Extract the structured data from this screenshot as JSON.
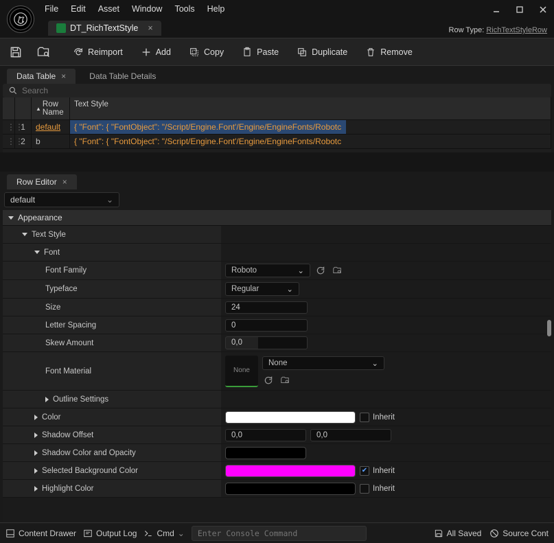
{
  "menu": {
    "file": "File",
    "edit": "Edit",
    "asset": "Asset",
    "window": "Window",
    "tools": "Tools",
    "help": "Help"
  },
  "file_tab": {
    "name": "DT_RichTextStyle"
  },
  "row_type": {
    "label": "Row Type:",
    "value": "RichTextStyleRow"
  },
  "toolbar": {
    "reimport": "Reimport",
    "add": "Add",
    "copy": "Copy",
    "paste": "Paste",
    "duplicate": "Duplicate",
    "remove": "Remove"
  },
  "tabs": {
    "data_table": "Data Table",
    "details": "Data Table Details",
    "row_editor": "Row Editor"
  },
  "search": {
    "placeholder": "Search"
  },
  "table": {
    "headers": {
      "row_name": "Row Name",
      "text_style": "Text Style"
    },
    "rows": [
      {
        "index": "1",
        "name": "default",
        "value": "{ \"Font\": { \"FontObject\": \"/Script/Engine.Font'/Engine/EngineFonts/Robotc"
      },
      {
        "index": "2",
        "name": "b",
        "value": "{ \"Font\": { \"FontObject\": \"/Script/Engine.Font'/Engine/EngineFonts/Robotc"
      }
    ]
  },
  "row_selector": {
    "value": "default"
  },
  "props": {
    "appearance": "Appearance",
    "text_style": "Text Style",
    "font": "Font",
    "font_family": {
      "label": "Font Family",
      "value": "Roboto"
    },
    "typeface": {
      "label": "Typeface",
      "value": "Regular"
    },
    "size": {
      "label": "Size",
      "value": "24"
    },
    "letter_spacing": {
      "label": "Letter Spacing",
      "value": "0"
    },
    "skew": {
      "label": "Skew Amount",
      "value": "0,0"
    },
    "font_material": {
      "label": "Font Material",
      "thumb": "None",
      "value": "None"
    },
    "outline": "Outline Settings",
    "color": {
      "label": "Color",
      "swatch": "#ffffff",
      "inherit_label": "Inherit",
      "inherit": false
    },
    "shadow_offset": {
      "label": "Shadow Offset",
      "x": "0,0",
      "y": "0,0"
    },
    "shadow_color": {
      "label": "Shadow Color and Opacity",
      "swatch": "#000000"
    },
    "selected_bg": {
      "label": "Selected Background Color",
      "swatch": "#ff00ff",
      "inherit_label": "Inherit",
      "inherit": true
    },
    "highlight": {
      "label": "Highlight Color",
      "swatch": "#000000",
      "inherit_label": "Inherit",
      "inherit": false
    }
  },
  "status": {
    "content_drawer": "Content Drawer",
    "output_log": "Output Log",
    "cmd": "Cmd",
    "console_placeholder": "Enter Console Command",
    "all_saved": "All Saved",
    "source_control": "Source Cont"
  }
}
